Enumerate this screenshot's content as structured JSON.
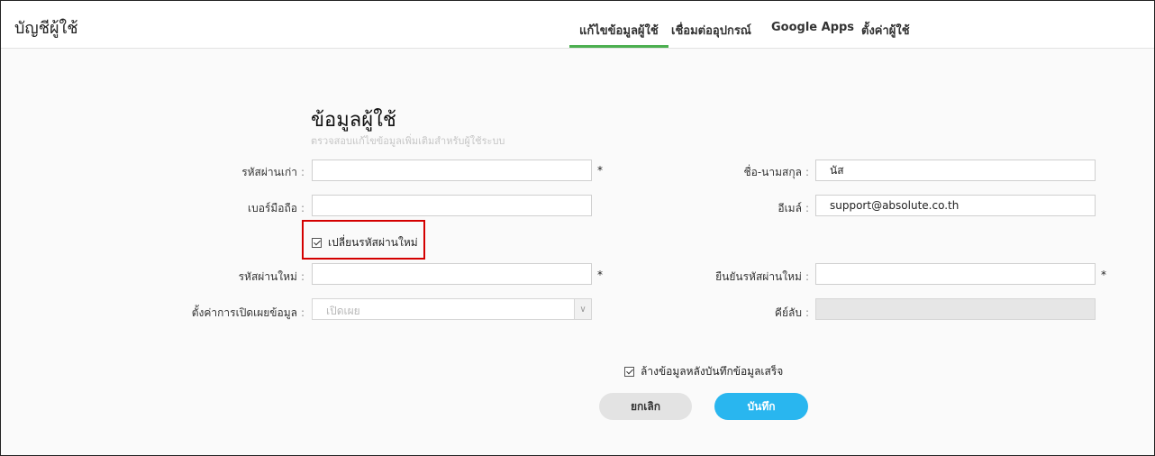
{
  "header": {
    "title": "บัญชีผู้ใช้",
    "tabs": [
      {
        "label": "แก้ไขข้อมูลผู้ใช้",
        "active": true
      },
      {
        "label": "เชื่อมต่ออุปกรณ์",
        "active": false
      },
      {
        "label": "Google Apps",
        "active": false
      },
      {
        "label": "ตั้งค่าผู้ใช้",
        "active": false
      }
    ],
    "accent_color": "#4caf50"
  },
  "form": {
    "title": "ข้อมูลผู้ใช้",
    "subtitle": "ตรวจสอบแก้ไขข้อมูลเพิ่มเติมสำหรับผู้ใช้ระบบ",
    "old_password": {
      "label": "รหัสผ่านเก่า",
      "value": "",
      "required_mark": "*"
    },
    "full_name": {
      "label": "ชื่อ-นามสกุล",
      "value": "นัส"
    },
    "mobile": {
      "label": "เบอร์มือถือ",
      "value": ""
    },
    "email": {
      "label": "อีเมล์",
      "value": "support@absolute.co.th"
    },
    "change_password": {
      "label": "เปลี่ยนรหัสผ่านใหม่",
      "checked": true
    },
    "new_password": {
      "label": "รหัสผ่านใหม่",
      "value": "",
      "required_mark": "*"
    },
    "confirm_password": {
      "label": "ยืนยันรหัสผ่านใหม่",
      "value": "",
      "required_mark": "*"
    },
    "privacy": {
      "label": "ตั้งค่าการเปิดเผยข้อมูล",
      "selected": "เปิดเผย"
    },
    "key": {
      "label": "คีย์ลับ",
      "value": ""
    },
    "clear_after_save": {
      "label": "ล้างข้อมูลหลังบันทึกข้อมูลเสร็จ",
      "checked": true
    },
    "colon": ":"
  },
  "buttons": {
    "cancel": "ยกเลิก",
    "save": "บันทึก",
    "save_color": "#29b6ef"
  }
}
